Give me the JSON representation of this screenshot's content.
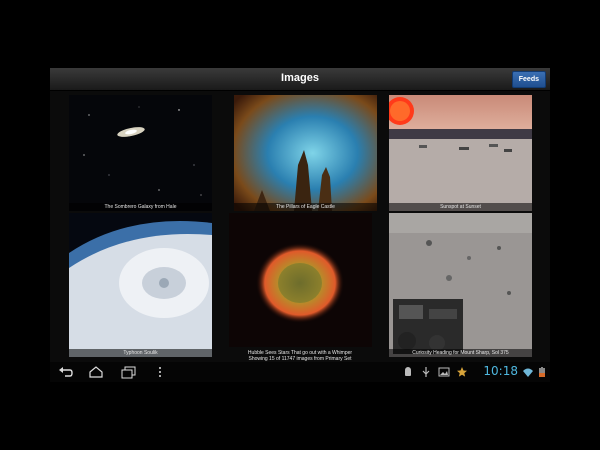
{
  "action_bar": {
    "title": "Images",
    "feeds_label": "Feeds"
  },
  "tiles": [
    {
      "caption": "The Sombrero Galaxy from Hale"
    },
    {
      "caption": "The Pillars of Eagle Castle"
    },
    {
      "caption": "Sunspot at Sunset"
    },
    {
      "caption": "Typhoon Soulik"
    },
    {
      "caption": "Hubble Sees Stars That go out with a Whimper"
    },
    {
      "caption": "Curiosity Heading for Mount Sharp, Sol 375"
    }
  ],
  "grid_status": "Showing 15 of 11747 images from Primary Set",
  "status_bar": {
    "time": "10:18"
  },
  "icons": {
    "back": "back-icon",
    "home": "home-icon",
    "recents": "recent-apps-icon",
    "menu": "overflow-menu-icon",
    "android": "android-icon",
    "usb": "usb-icon",
    "image": "image-icon",
    "star": "star-icon",
    "wifi": "wifi-icon",
    "battery": "battery-icon"
  },
  "colors": {
    "accent": "#4fb8e0",
    "feeds_button": "#2a5fa2"
  }
}
